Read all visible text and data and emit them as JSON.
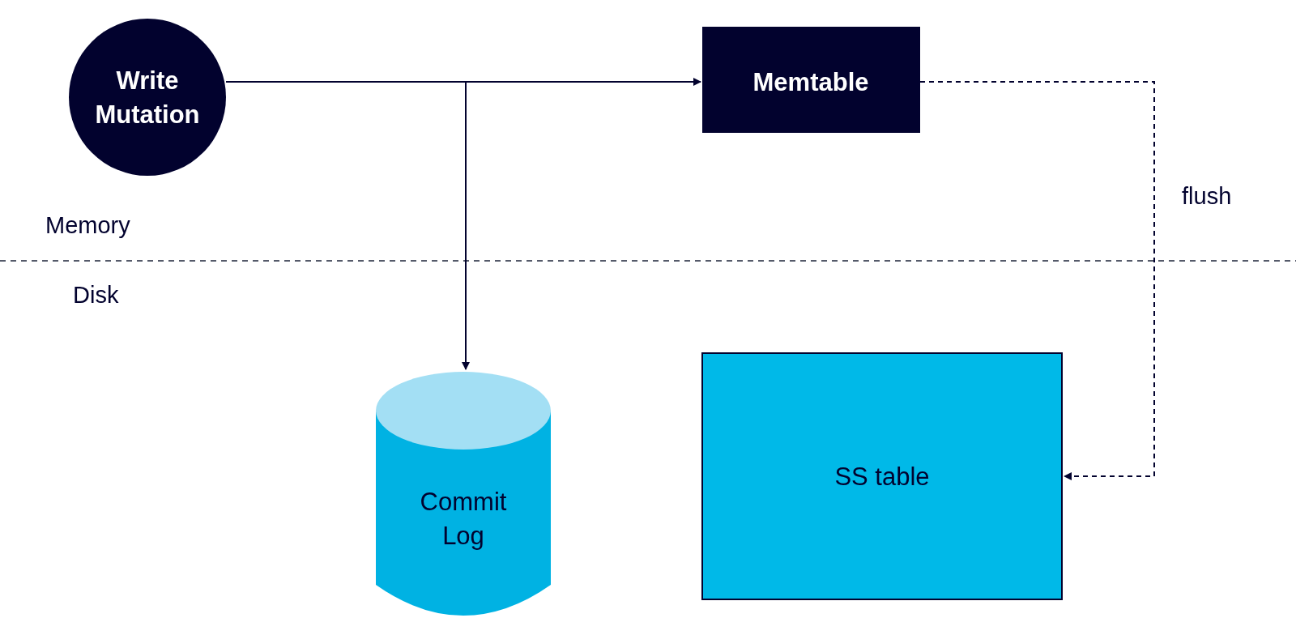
{
  "nodes": [
    {
      "kind": "circle",
      "label_lines": [
        "Write",
        "Mutation"
      ]
    },
    {
      "kind": "box",
      "label_lines": [
        "Memtable"
      ]
    },
    {
      "kind": "cylinder",
      "label_lines": [
        "Commit",
        "Log"
      ]
    },
    {
      "kind": "table",
      "label_lines": [
        "SS table"
      ]
    }
  ],
  "layers": [
    "Memory",
    "Disk"
  ],
  "edge_label": "flush"
}
